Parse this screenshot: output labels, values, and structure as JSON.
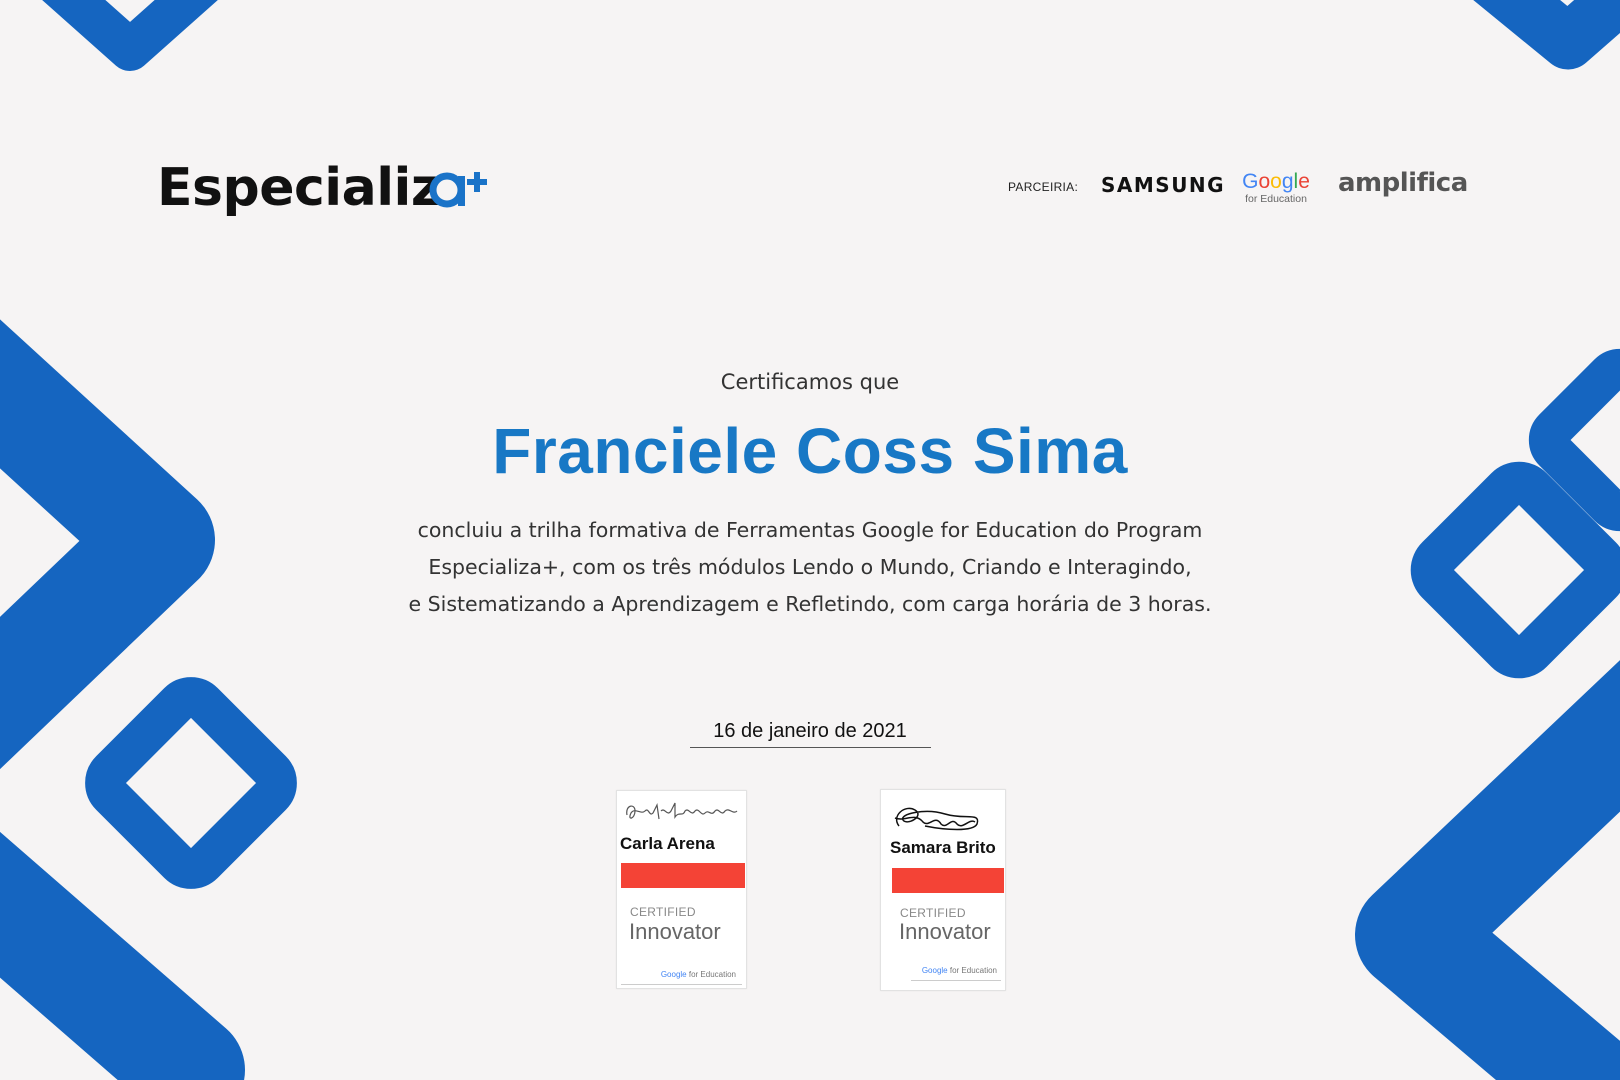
{
  "logo": {
    "text": "Especializ",
    "mark": "a+"
  },
  "partners": {
    "label": "PARCEIRIA:",
    "samsung": "SAMSUNG",
    "google_letters": [
      "G",
      "o",
      "o",
      "g",
      "l",
      "e"
    ],
    "google_sub": "for Education",
    "amplifica": "amplifica"
  },
  "certificate": {
    "intro": "Certificamos que",
    "name": "Franciele Coss Sima",
    "body_lines": [
      "concluiu a trilha formativa de Ferramentas Google for Education do Program",
      "Especializa+, com os três módulos Lendo o Mundo, Criando e Interagindo,",
      "e Sistematizando a Aprendizagem e Refletindo, com carga horária de 3 horas."
    ],
    "date": "16 de janeiro de 2021"
  },
  "signatories": [
    {
      "name": "Carla Arena",
      "certified": "CERTIFIED",
      "role": "Innovator",
      "footer_google": "Google",
      "footer_rest": " for Education"
    },
    {
      "name": "Samara Brito",
      "certified": "CERTIFIED",
      "role": "Innovator",
      "footer_google": "Google",
      "footer_rest": " for Education"
    }
  ],
  "colors": {
    "accent": "#1565c0",
    "name": "#1878c5",
    "badge_bar": "#f44336",
    "background": "#f6f4f4"
  }
}
